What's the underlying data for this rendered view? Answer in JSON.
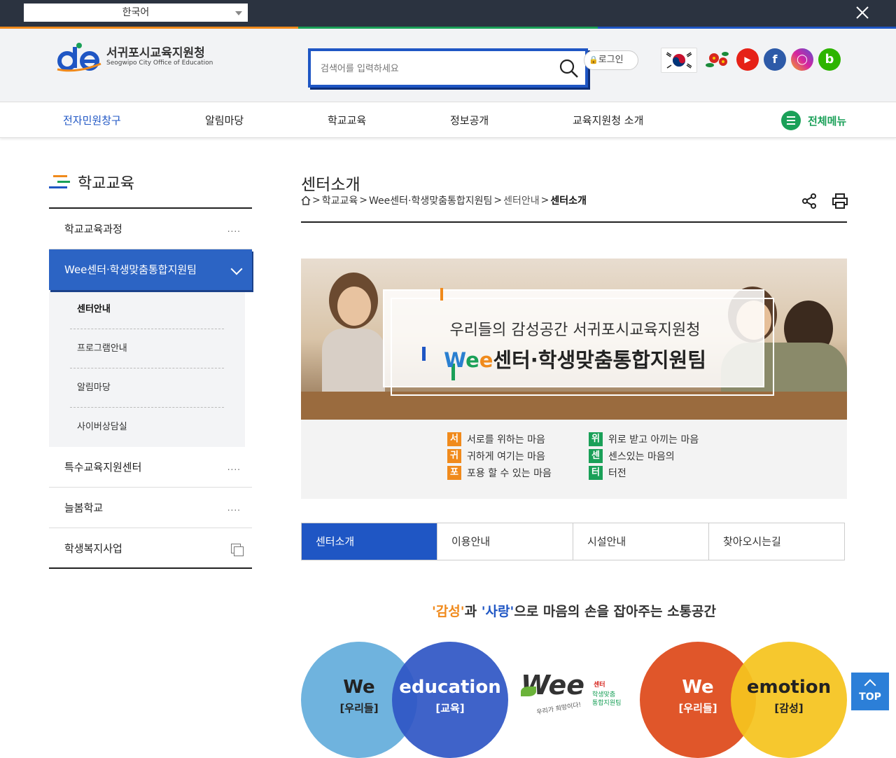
{
  "topbar": {
    "language": "한국어"
  },
  "header": {
    "logo_title": "서귀포시교육지원청",
    "logo_sub": "Seogwipo City Office of Education",
    "search_placeholder": "검색어를 입력하세요",
    "login_label": "로그인"
  },
  "gnb": {
    "items": [
      "전자민원창구",
      "알림마당",
      "학교교육",
      "정보공개",
      "교육지원청 소개"
    ],
    "all_menu": "전체메뉴"
  },
  "sidebar": {
    "title": "학교교육",
    "items": [
      {
        "label": "학교교육과정",
        "marker": "...."
      },
      {
        "label": "Wee센터·학생맞춤통합지원팀"
      },
      {
        "label": "특수교육지원센터",
        "marker": "...."
      },
      {
        "label": "늘봄학교",
        "marker": "...."
      },
      {
        "label": "학생복지사업"
      }
    ],
    "sub_items": [
      "센터안내",
      "프로그램안내",
      "알림마당",
      "사이버상담실"
    ]
  },
  "content": {
    "page_title": "센터소개",
    "breadcrumb": {
      "sep": ">",
      "items": [
        "학교교육",
        "Wee센터·학생맞춤통합지원팀",
        "센터안내",
        "센터소개"
      ]
    },
    "banner": {
      "line1": "우리들의 감성공간 서귀포시교육지원청",
      "line2_we": "W",
      "line2_e1": "e",
      "line2_e2": "e",
      "line2_rest": "센터·학생맞춤통합지원팀"
    },
    "values": [
      {
        "char": "서",
        "text": "서로를 위하는 마음"
      },
      {
        "char": "귀",
        "text": "귀하게 여기는 마음"
      },
      {
        "char": "포",
        "text": "포용 할 수 있는 마음"
      },
      {
        "char": "위",
        "text": "위로 받고 아끼는 마음"
      },
      {
        "char": "센",
        "text": "센스있는 마음의"
      },
      {
        "char": "터",
        "text": "터전"
      }
    ],
    "tabs": [
      "센터소개",
      "이용안내",
      "시설안내",
      "찾아오시는길"
    ],
    "tagline": {
      "q1": "'감성'",
      "mid1": "과 ",
      "q2": "'사랑'",
      "rest": "으로 마음의 손을 잡아주는 소통공간"
    },
    "bubbles": [
      {
        "t1": "We",
        "t2": "[우리들]"
      },
      {
        "t1": "education",
        "t2": "[교육]"
      },
      {
        "t1": "We",
        "t2": "[우리들]"
      },
      {
        "t1": "emotion",
        "t2": "[감성]"
      }
    ],
    "wee_logo": {
      "main": "Wee",
      "sub1": "센터",
      "sub2": "학생맞춤",
      "sub3": "통합지원팀",
      "slogan": "우리가 희망이다!"
    }
  },
  "top_button": "TOP",
  "colors": {
    "primary_blue": "#1f56c4",
    "green": "#1aa058",
    "orange": "#f08a1c"
  }
}
